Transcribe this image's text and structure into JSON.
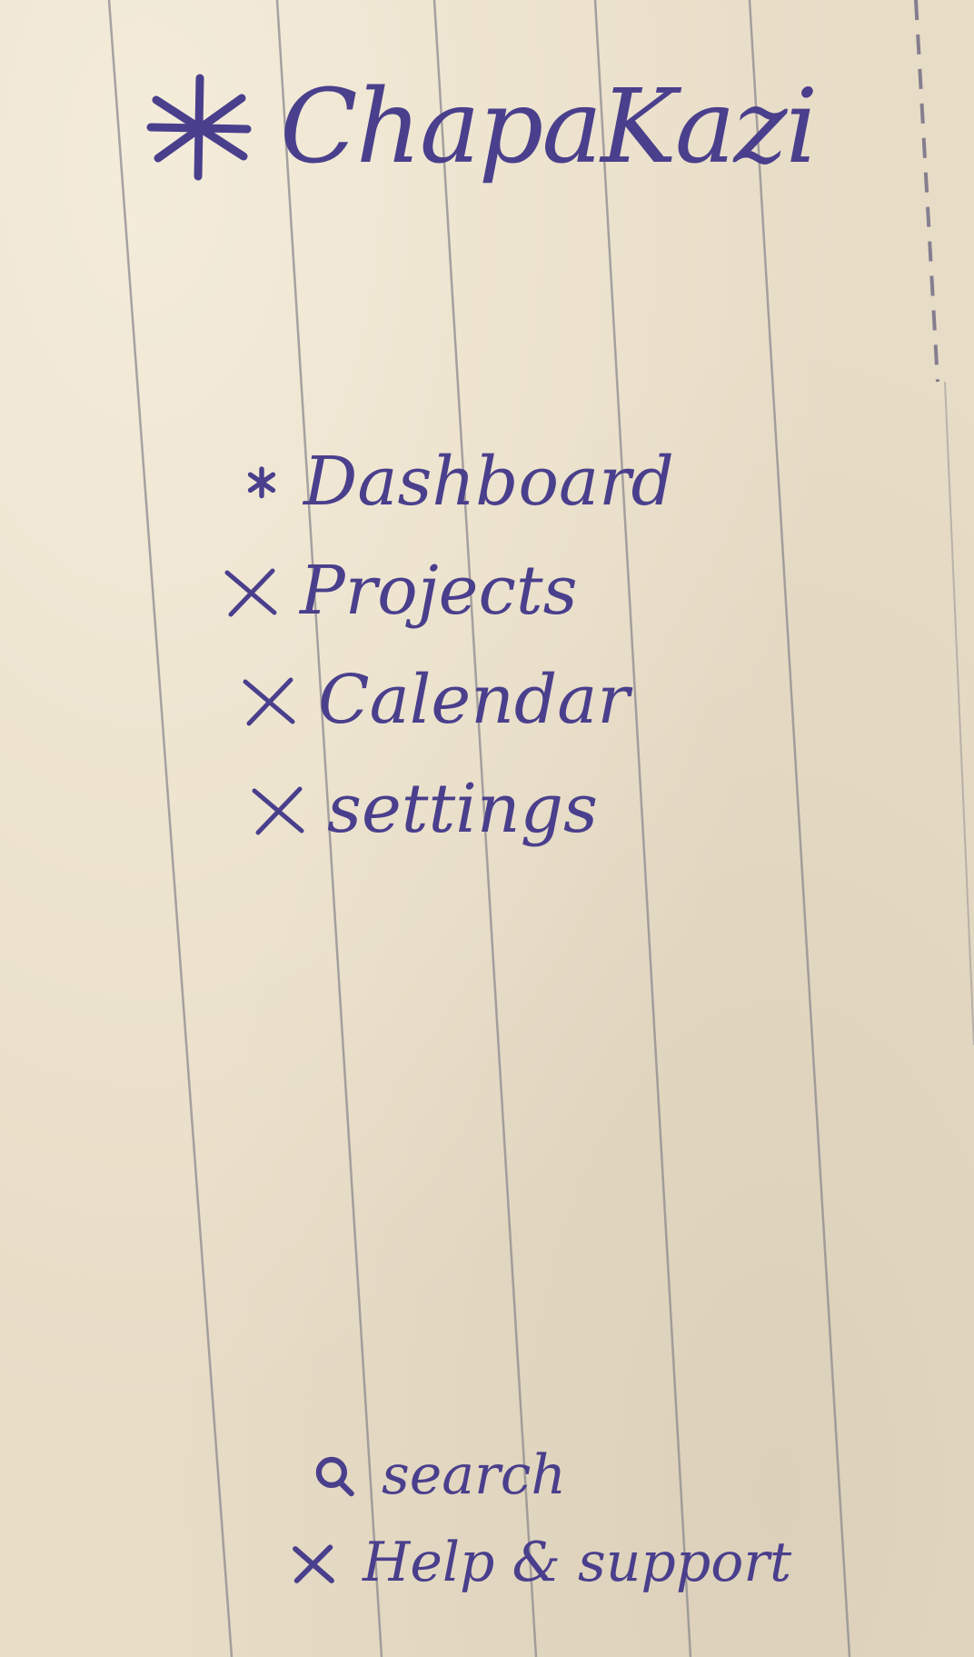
{
  "app": {
    "brand_name": "ChapaKazi",
    "brand_icon": "asterisk-icon"
  },
  "sidebar": {
    "items": [
      {
        "label": "Dashboard",
        "icon": "asterisk-bullet-icon",
        "active": true
      },
      {
        "label": "Projects",
        "icon": "x-bullet-icon",
        "active": false
      },
      {
        "label": "Calendar",
        "icon": "x-bullet-icon",
        "active": false
      },
      {
        "label": "settings",
        "icon": "x-bullet-icon",
        "active": false
      }
    ],
    "bottom_items": [
      {
        "label": "search",
        "icon": "search-icon"
      },
      {
        "label": "Help & support",
        "icon": "x-bullet-icon"
      }
    ]
  },
  "colors": {
    "ink": "#4a3f8c",
    "paper": "#e7dcc6",
    "rule": "#8c8a8f"
  }
}
